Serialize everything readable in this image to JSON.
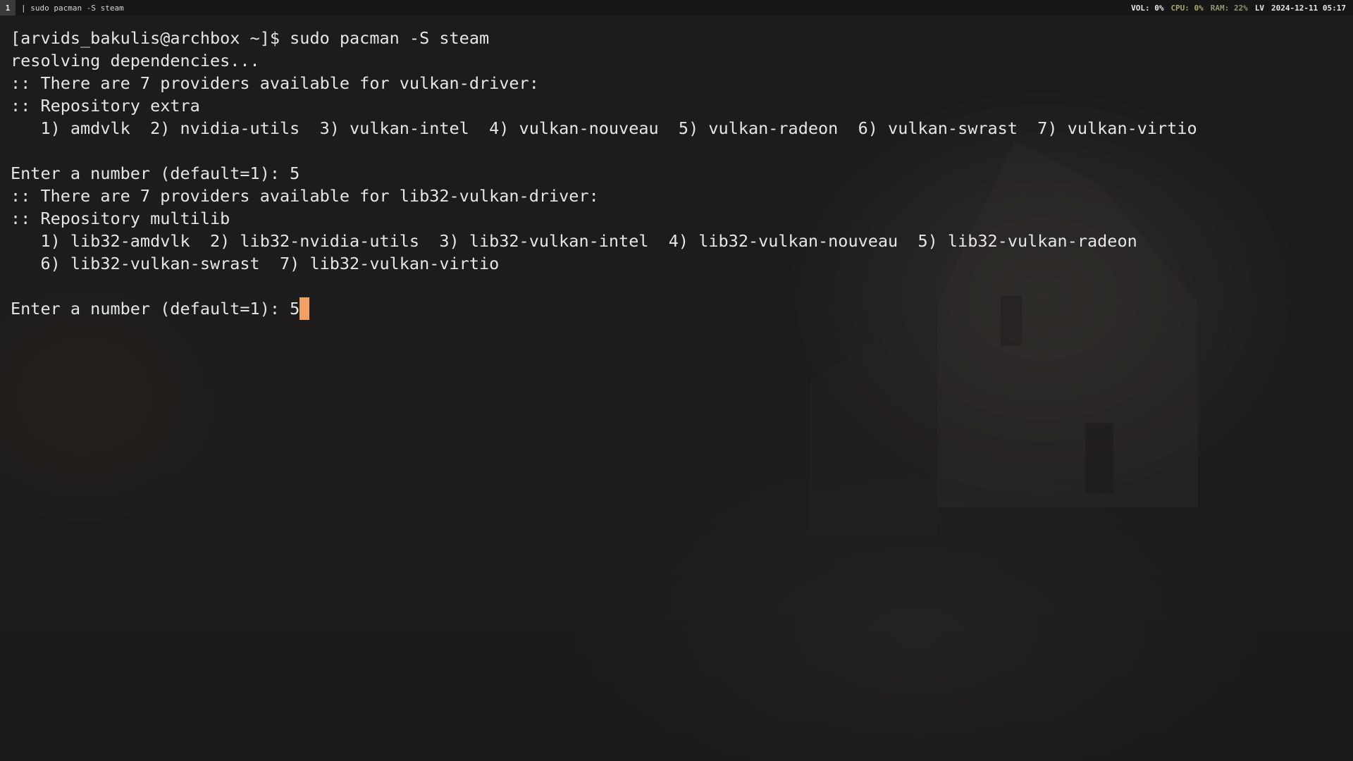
{
  "topbar": {
    "workspace": "1",
    "window_title": "| sudo pacman -S steam",
    "volume": "VOL: 0%",
    "cpu": "CPU: 0%",
    "ram": "RAM: 22%",
    "layout": "LV",
    "clock": "2024-12-11 05:17",
    "colors": {
      "cpu": "#a8a86a",
      "ram": "#8a9a6a"
    }
  },
  "terminal": {
    "lines": [
      "[arvids_bakulis@archbox ~]$ sudo pacman -S steam",
      "resolving dependencies...",
      ":: There are 7 providers available for vulkan-driver:",
      ":: Repository extra",
      "   1) amdvlk  2) nvidia-utils  3) vulkan-intel  4) vulkan-nouveau  5) vulkan-radeon  6) vulkan-swrast  7) vulkan-virtio",
      "",
      "Enter a number (default=1): 5",
      ":: There are 7 providers available for lib32-vulkan-driver:",
      ":: Repository multilib",
      "   1) lib32-amdvlk  2) lib32-nvidia-utils  3) lib32-vulkan-intel  4) lib32-vulkan-nouveau  5) lib32-vulkan-radeon",
      "   6) lib32-vulkan-swrast  7) lib32-vulkan-virtio",
      ""
    ],
    "input_prompt": "Enter a number (default=1): ",
    "input_value": "5",
    "cursor_color": "#f0a060"
  }
}
